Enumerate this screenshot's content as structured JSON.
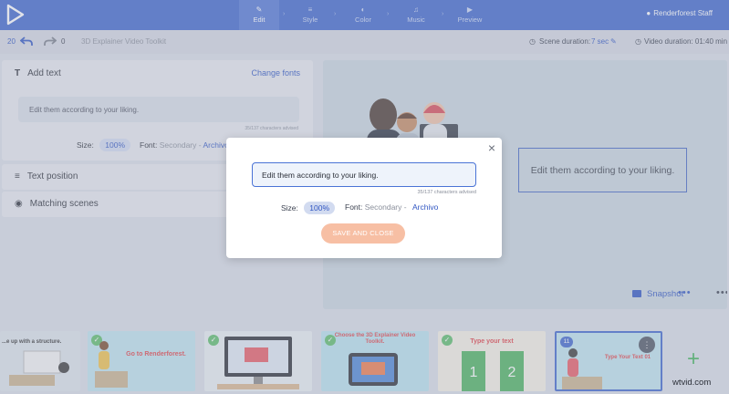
{
  "topbar": {
    "steps": [
      {
        "label": "Edit",
        "glyph": "✎",
        "active": true
      },
      {
        "label": "Style",
        "glyph": "≡",
        "active": false
      },
      {
        "label": "Color",
        "glyph": "◐",
        "active": false
      },
      {
        "label": "Music",
        "glyph": "♫",
        "active": false
      },
      {
        "label": "Preview",
        "glyph": "▶",
        "active": false
      }
    ],
    "separator": "›",
    "user_name": "Renderforest Staff"
  },
  "toolbar": {
    "undo_count": "20",
    "redo_count": "0",
    "project_title": "3D Explainer Video Toolkit",
    "scene_duration_label": "Scene duration:",
    "scene_duration_value": "7 sec",
    "video_duration_label": "Video duration: 01:40 min"
  },
  "left_panel": {
    "add_text_title": "Add text",
    "change_fonts": "Change fonts",
    "text_value": "Edit them according to your liking.",
    "char_count": "35/137 characters advised",
    "size_label": "Size:",
    "size_value": "100%",
    "font_label": "Font:",
    "font_secondary": "Secondary -",
    "font_name": "Archivo",
    "text_position": "Text position",
    "matching_scenes": "Matching scenes"
  },
  "preview": {
    "text": "Edit them according to your liking.",
    "snapshot": "Snapshot",
    "more": "•••"
  },
  "modal": {
    "close": "×",
    "text_value": "Edit them according to your liking.",
    "char_count": "35/137 characters advised",
    "size_label": "Size:",
    "size_value": "100%",
    "font_label": "Font:",
    "font_secondary": "Secondary -",
    "font_name": "Archivo",
    "save_button": "SAVE AND CLOSE"
  },
  "thumbnails": [
    {
      "title": "...e up with a structure.",
      "check": ""
    },
    {
      "title": "Go to Renderforest.",
      "check": "✓"
    },
    {
      "title": "",
      "check": "✓"
    },
    {
      "title": "Choose the 3D Explainer Video Toolkit.",
      "check": "✓"
    },
    {
      "title": "Type your text",
      "check": "✓"
    },
    {
      "title": "Type Your Text 01",
      "number": "11",
      "menu": "⋮"
    }
  ],
  "add_scene": "+",
  "watermark": "wtvid.com",
  "colors": {
    "brand": "#3e66cc",
    "accent": "#f7bfa4",
    "success": "#5cbe6a"
  }
}
